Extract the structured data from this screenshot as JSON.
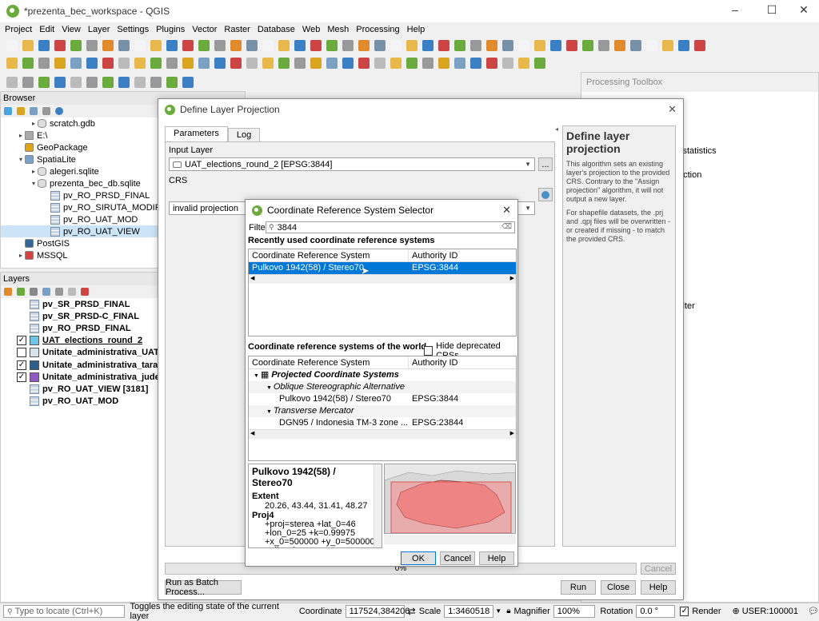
{
  "app": {
    "title": "*prezenta_bec_workspace - QGIS"
  },
  "menu": [
    "Project",
    "Edit",
    "View",
    "Layer",
    "Settings",
    "Plugins",
    "Vector",
    "Raster",
    "Database",
    "Web",
    "Mesh",
    "Processing",
    "Help"
  ],
  "browser": {
    "title": "Browser",
    "items": [
      {
        "label": "scratch.gdb",
        "indent": 1,
        "icon": "db-icon",
        "expander": "▸"
      },
      {
        "label": "E:\\",
        "indent": 0,
        "icon": "drive-icon",
        "expander": "▸"
      },
      {
        "label": "GeoPackage",
        "indent": 0,
        "icon": "geopackage-icon",
        "expander": ""
      },
      {
        "label": "SpatiaLite",
        "indent": 0,
        "icon": "spatialite-icon",
        "expander": "▾"
      },
      {
        "label": "alegeri.sqlite",
        "indent": 1,
        "icon": "db-icon",
        "expander": "▸"
      },
      {
        "label": "prezenta_bec_db.sqlite",
        "indent": 1,
        "icon": "db-icon",
        "expander": "▾"
      },
      {
        "label": "pv_RO_PRSD_FINAL",
        "indent": 2,
        "icon": "table-icon",
        "expander": ""
      },
      {
        "label": "pv_RO_SIRUTA_MODIFY",
        "indent": 2,
        "icon": "table-icon",
        "expander": ""
      },
      {
        "label": "pv_RO_UAT_MOD",
        "indent": 2,
        "icon": "table-icon",
        "expander": ""
      },
      {
        "label": "pv_RO_UAT_VIEW",
        "indent": 2,
        "icon": "table-icon",
        "expander": "",
        "selected": true
      },
      {
        "label": "PostGIS",
        "indent": 0,
        "icon": "postgis-icon",
        "expander": ""
      },
      {
        "label": "MSSQL",
        "indent": 0,
        "icon": "mssql-icon",
        "expander": "▸"
      }
    ]
  },
  "layers": {
    "title": "Layers",
    "items": [
      {
        "label": "pv_SR_PRSD_FINAL",
        "check": "",
        "type": "table"
      },
      {
        "label": "pv_SR_PRSD-C_FINAL",
        "check": "",
        "type": "table"
      },
      {
        "label": "pv_RO_PRSD_FINAL",
        "check": "",
        "type": "table"
      },
      {
        "label": "UAT_elections_round_2",
        "check": "✓",
        "type": "swatch",
        "color": "#6ec6e4",
        "underline": true
      },
      {
        "label": "Unitate_administrativa_UAT",
        "check": "",
        "type": "swatch",
        "color": "#d7e4ec"
      },
      {
        "label": "Unitate_administrativa_tara",
        "check": "✓",
        "type": "swatch",
        "color": "#2b5f8a"
      },
      {
        "label": "Unitate_administrativa_judet",
        "check": "✓",
        "type": "swatch",
        "color": "#8e5bc4"
      },
      {
        "label": "pv_RO_UAT_VIEW [3181]",
        "check": "",
        "type": "table"
      },
      {
        "label": "pv_RO_UAT_MOD",
        "check": "",
        "type": "table"
      }
    ]
  },
  "toolbox": {
    "title": "Processing Toolbox",
    "fragments": [
      "l statistics",
      "ection",
      "filter"
    ]
  },
  "define_dialog": {
    "title": "Define Layer Projection",
    "tabs": [
      "Parameters",
      "Log"
    ],
    "input_layer_label": "Input Layer",
    "input_layer_value": "UAT_elections_round_2 [EPSG:3844]",
    "crs_label": "CRS",
    "crs_value": "invalid projection",
    "help_title": "Define layer projection",
    "help_p1": "This algorithm sets an existing layer's projection to the provided CRS. Contrary to the \"Assign projection\" algorithm, it will not output a new layer.",
    "help_p2": "For shapefile datasets, the .prj and .qpj files will be overwritten - or created if missing - to match the provided CRS.",
    "progress": "0%",
    "progress_fraction": 0,
    "cancel": "Cancel",
    "batch": "Run as Batch Process...",
    "run": "Run",
    "close": "Close",
    "help": "Help",
    "browse": "..."
  },
  "crs_dialog": {
    "title": "Coordinate Reference System Selector",
    "filter_label": "Filter",
    "filter_value": "3844",
    "recent_label": "Recently used coordinate reference systems",
    "col_crs": "Coordinate Reference System",
    "col_auth": "Authority ID",
    "recent_rows": [
      {
        "name": "Pulkovo 1942(58) / Stereo70",
        "auth": "EPSG:3844"
      }
    ],
    "world_label": "Coordinate reference systems of the world",
    "hide_deprecated": "Hide deprecated CRSs",
    "world_rows": [
      {
        "name": "Projected Coordinate Systems",
        "auth": "",
        "level": 0,
        "kind": "root"
      },
      {
        "name": "Oblique Stereographic Alternative",
        "auth": "",
        "level": 1,
        "kind": "group"
      },
      {
        "name": "Pulkovo 1942(58) / Stereo70",
        "auth": "EPSG:3844",
        "level": 2,
        "kind": "item"
      },
      {
        "name": "Transverse Mercator",
        "auth": "",
        "level": 1,
        "kind": "group"
      },
      {
        "name": "DGN95 / Indonesia TM-3 zone ...",
        "auth": "EPSG:23844",
        "level": 2,
        "kind": "item"
      }
    ],
    "info_title": "Pulkovo 1942(58) / Stereo70",
    "extent_label": "Extent",
    "extent_value": "20.26, 43.44, 31.41, 48.27",
    "proj4_label": "Proj4",
    "proj4_lines": [
      "+proj=sterea +lat_0=46",
      "+lon_0=25 +k=0.99975",
      "+x_0=500000 +y_0=500000",
      "+ellps=krass"
    ],
    "ok": "OK",
    "cancel": "Cancel",
    "help": "Help"
  },
  "status": {
    "locate_placeholder": "Type to locate (Ctrl+K)",
    "message": "Toggles the editing state of the current layer",
    "coord_label": "Coordinate",
    "coord_value": "117524,384206",
    "scale_label": "Scale",
    "scale_value": "1:3460518",
    "magnifier_label": "Magnifier",
    "magnifier_value": "100%",
    "rotation_label": "Rotation",
    "rotation_value": "0.0 °",
    "render_label": "Render",
    "user": "USER:100001"
  }
}
